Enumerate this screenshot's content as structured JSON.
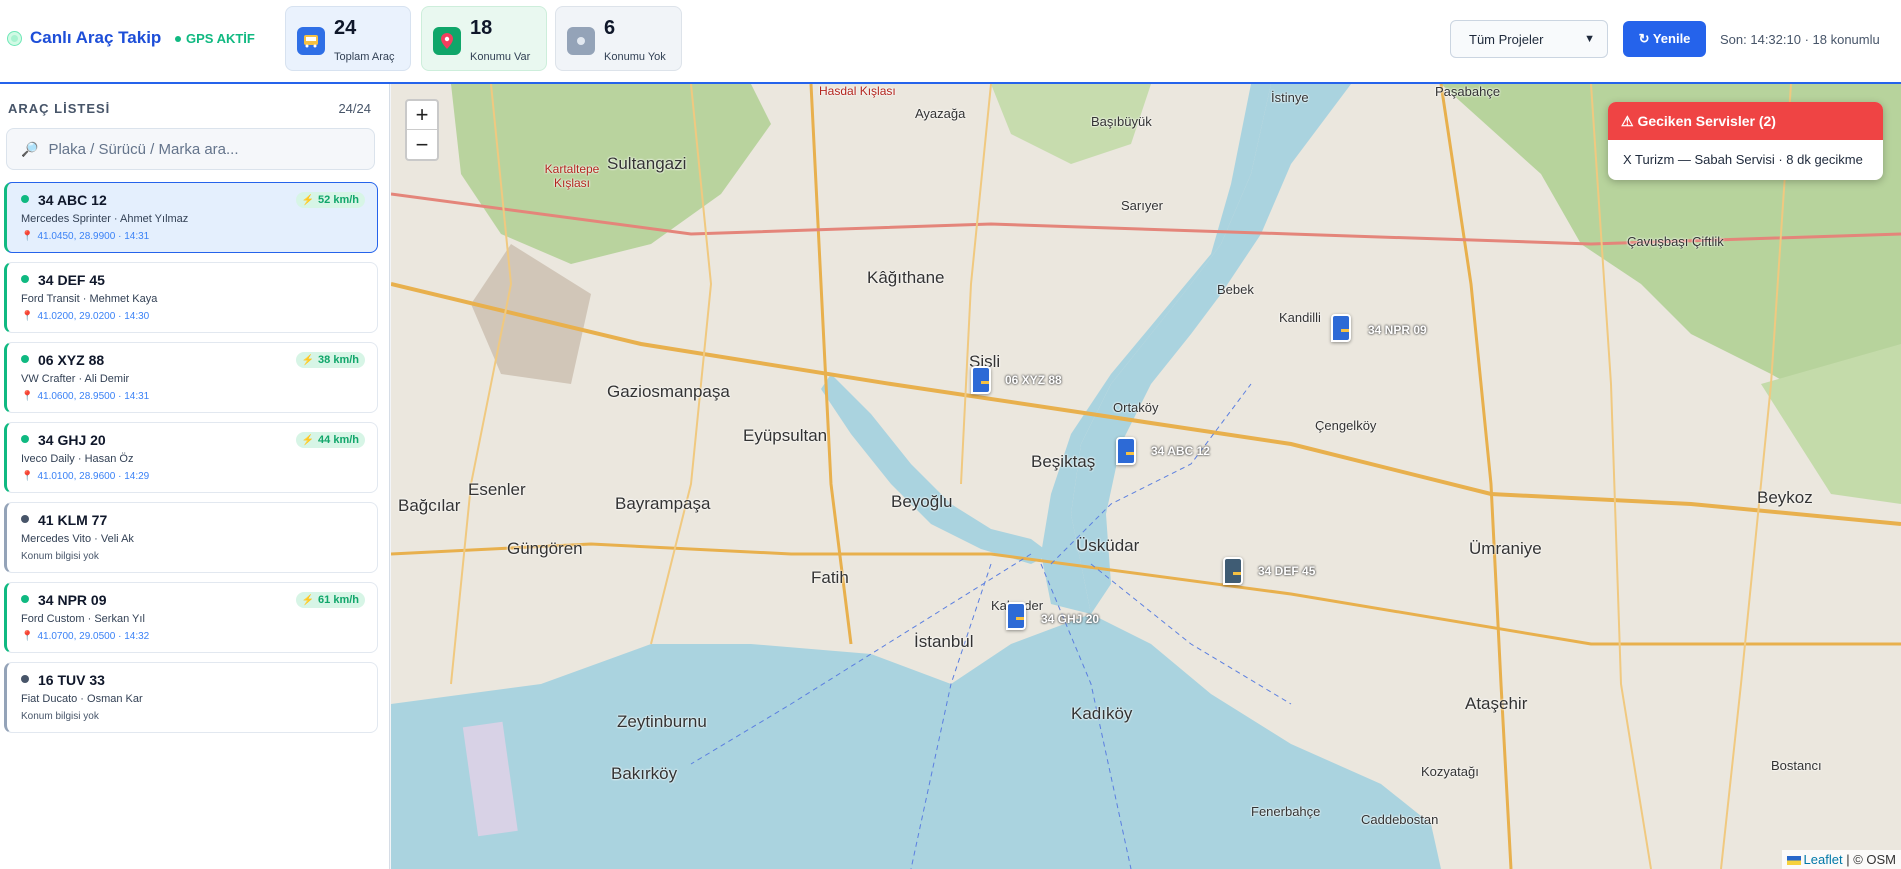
{
  "header": {
    "title": "Canlı Araç Takip",
    "gps_status": "GPS AKTİF",
    "stats": {
      "total": {
        "value": "24",
        "label": "Toplam Araç"
      },
      "with_location": {
        "value": "18",
        "label": "Konumu Var"
      },
      "without_location": {
        "value": "6",
        "label": "Konumu Yok"
      }
    },
    "project_filter": "Tüm Projeler",
    "refresh_label": "↻ Yenile",
    "last_update": "Son: 14:32:10 · 18 konumlu"
  },
  "sidebar": {
    "title": "ARAÇ LİSTESİ",
    "count": "24/24",
    "search_placeholder": "Plaka / Sürücü / Marka ara...",
    "vehicles": [
      {
        "plate": "34 ABC 12",
        "info": "Mercedes Sprinter · Ahmet Yılmaz",
        "location": "41.0450, 28.9900 · 14:31",
        "speed": "52 km/h"
      },
      {
        "plate": "34 DEF 45",
        "info": "Ford Transit · Mehmet Kaya",
        "location": "41.0200, 29.0200 · 14:30"
      },
      {
        "plate": "06 XYZ 88",
        "info": "VW Crafter · Ali Demir",
        "location": "41.0600, 28.9500 · 14:31",
        "speed": "38 km/h"
      },
      {
        "plate": "34 GHJ 20",
        "info": "Iveco Daily · Hasan Öz",
        "location": "41.0100, 28.9600 · 14:29",
        "speed": "44 km/h"
      },
      {
        "plate": "41 KLM 77",
        "info": "Mercedes Vito · Veli Ak",
        "location": "Konum bilgisi yok"
      },
      {
        "plate": "34 NPR 09",
        "info": "Ford Custom · Serkan Yıl",
        "location": "41.0700, 29.0500 · 14:32",
        "speed": "61 km/h"
      },
      {
        "plate": "16 TUV 33",
        "info": "Fiat Ducato · Osman Kar",
        "location": "Konum bilgisi yok"
      }
    ]
  },
  "map": {
    "zoom_in": "+",
    "zoom_out": "−",
    "markers": [
      {
        "plate": "06 XYZ 88"
      },
      {
        "plate": "34 ABC 12"
      },
      {
        "plate": "34 NPR 09"
      },
      {
        "plate": "34 DEF 45"
      },
      {
        "plate": "34 GHJ 20"
      }
    ],
    "places": [
      "Kâğıthane",
      "Şişli",
      "Beşiktaş",
      "Beyoğlu",
      "İstanbul",
      "Üsküdar",
      "Kadıköy",
      "Ataşehir",
      "Ümraniye",
      "Fatih",
      "Bayrampaşa",
      "Esenler",
      "Güngören",
      "Bağcılar",
      "Zeytinburnu",
      "Bakırköy",
      "Eyüpsultan",
      "Gaziosmanpaşa",
      "Sultangazi",
      "Sarıyer",
      "Beykoz",
      "Çengelköy",
      "Kandilli",
      "Bebek",
      "Ortaköy",
      "Kartaltepe Kışlası",
      "Hasdal Kışlası",
      "Başıbüyük",
      "İstinye",
      "Paşabahçe",
      "Çavuşbaşı Çiftlik",
      "Kozyatağı",
      "Bostancı",
      "Fenerbahçe",
      "Caddebostan",
      "Ayazağa",
      "Kalender"
    ],
    "alert": {
      "title": "⚠ Geciken Servisler (2)",
      "body": "X Turizm — Sabah Servisi · 8 dk gecikme"
    },
    "attribution": {
      "leaflet": "Leaflet",
      "osm": "| © OSM"
    }
  }
}
